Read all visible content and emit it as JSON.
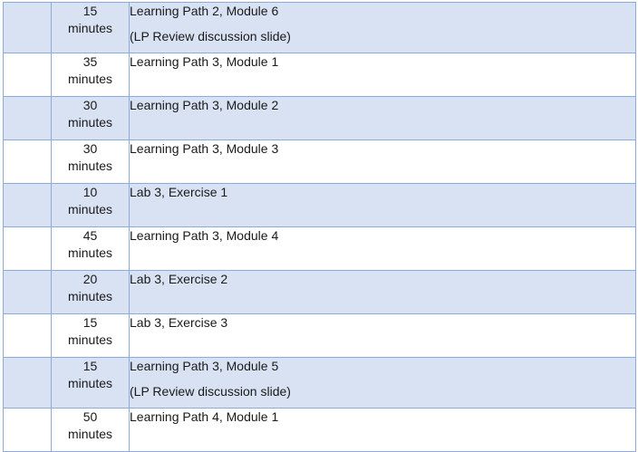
{
  "rows": [
    {
      "num": "15",
      "unit": "minutes",
      "text": "Learning Path 2, Module 6",
      "note": "(LP Review discussion slide)"
    },
    {
      "num": "35",
      "unit": "minutes",
      "text": "Learning Path 3, Module 1",
      "note": ""
    },
    {
      "num": "30",
      "unit": "minutes",
      "text": "Learning Path 3, Module 2",
      "note": ""
    },
    {
      "num": "30",
      "unit": "minutes",
      "text": "Learning Path 3, Module 3",
      "note": ""
    },
    {
      "num": "10",
      "unit": "minutes",
      "text": "Lab 3, Exercise 1",
      "note": ""
    },
    {
      "num": "45",
      "unit": "minutes",
      "text": "Learning Path 3, Module 4",
      "note": ""
    },
    {
      "num": "20",
      "unit": "minutes",
      "text": "Lab 3, Exercise 2",
      "note": ""
    },
    {
      "num": "15",
      "unit": "minutes",
      "text": "Lab 3, Exercise 3",
      "note": ""
    },
    {
      "num": "15",
      "unit": "minutes",
      "text": "Learning Path 3, Module 5",
      "note": "(LP Review discussion slide)"
    },
    {
      "num": "50",
      "unit": "minutes",
      "text": "Learning Path 4, Module 1",
      "note": ""
    }
  ]
}
